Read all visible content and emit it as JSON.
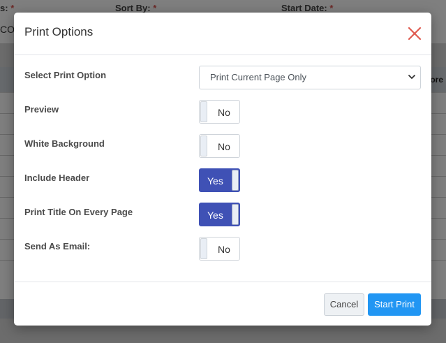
{
  "background": {
    "filter_labels": [
      {
        "text": "s:",
        "req": "*"
      },
      {
        "text": "Sort By:",
        "req": "*"
      },
      {
        "text": "Start Date:",
        "req": "*"
      }
    ],
    "filter_value": "COH",
    "table_header_partial": "ore"
  },
  "modal": {
    "title": "Print Options",
    "print_option": {
      "label": "Select Print Option",
      "value": "Print Current Page Only"
    },
    "toggles": [
      {
        "label": "Preview",
        "state": "No"
      },
      {
        "label": "White Background",
        "state": "No"
      },
      {
        "label": "Include Header",
        "state": "Yes"
      },
      {
        "label": "Print Title On Every Page",
        "state": "Yes"
      },
      {
        "label": "Send As Email:",
        "state": "No"
      }
    ],
    "cancel_label": "Cancel",
    "start_label": "Start Print"
  },
  "colors": {
    "toggle_on": "#3f51b5",
    "primary_button": "#2196f3",
    "close_icon": "#e05a4f"
  }
}
